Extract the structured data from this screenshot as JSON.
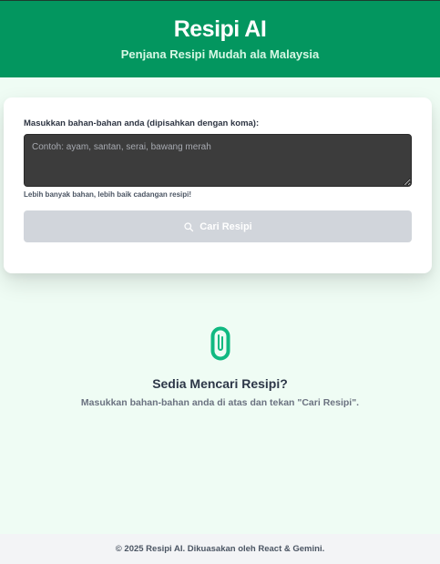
{
  "header": {
    "title": "Resipi AI",
    "subtitle": "Penjana Resipi Mudah ala Malaysia"
  },
  "form": {
    "label": "Masukkan bahan-bahan anda (dipisahkan dengan koma):",
    "placeholder": "Contoh: ayam, santan, serai, bawang merah",
    "value": "",
    "helper": "Lebih banyak bahan, lebih baik cadangan resipi!",
    "button_label": "Cari Resipi",
    "button_icon": "search-icon"
  },
  "empty_state": {
    "icon": "paperclip-icon",
    "title": "Sedia Mencari Resipi?",
    "text": "Masukkan bahan-bahan anda di atas dan tekan \"Cari Resipi\"."
  },
  "footer": {
    "text": "© 2025 Resipi AI. Dikuasakan oleh React & Gemini."
  },
  "colors": {
    "brand_green": "#03965f",
    "icon_green": "#10b981",
    "button_disabled": "#d1d5db"
  }
}
